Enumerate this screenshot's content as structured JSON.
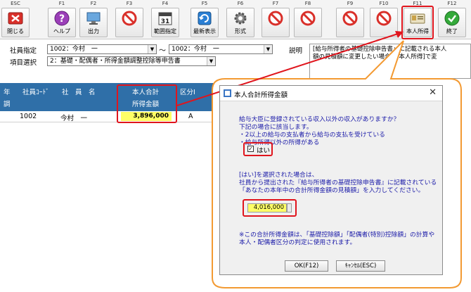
{
  "toolbar": {
    "fkeys": [
      "ESC",
      "F1",
      "F2",
      "F3",
      "F4",
      "F5",
      "F6",
      "F7",
      "F8",
      "F9",
      "F10",
      "F11",
      "F12"
    ],
    "buttons": {
      "close": "閉じる",
      "help": "ヘルプ",
      "output": "出力",
      "range": "範囲指定",
      "refresh": "最新表示",
      "format": "形式",
      "self_income": "本人所得",
      "exit": "終了"
    },
    "calendar_num": "31"
  },
  "header": {
    "employee_label": "社員指定",
    "employee_from": "1002：今村　一",
    "employee_to": "1002：今村　一",
    "tilde": "～",
    "item_label": "項目選択",
    "item_value": "2：基礎・配偶者・所得金額調整控除等申告書",
    "desc_label": "説明",
    "desc_lines": [
      "[給与所得者の基礎控除申告書」に記載される本人",
      "額の見積額に変更したい場合に[本人所得]で変"
    ]
  },
  "grid": {
    "col_nen": "年",
    "col_cho": "調",
    "col_code": "社員ｺｰﾄﾞ",
    "col_name": "社　員　名",
    "col_income_1": "本人合計",
    "col_income_2": "所得金額",
    "col_kubun": "区分Ⅰ",
    "row": {
      "code": "1002",
      "name": "今村　一",
      "amount": "3,896,000",
      "kubun": "A"
    }
  },
  "dialog": {
    "title": "本人合計所得金額",
    "close": "✕",
    "q_lines": [
      "給与大臣に登録されている収入以外の収入がありますか？",
      "下記の場合に該当します。",
      "・2以上の給与の支払者から給与の支払を受けている",
      "・給与所得以外の所得がある"
    ],
    "check_mark": "✓",
    "check_label": "はい",
    "info_lines": [
      "[はい]を選択された場合は、",
      "社員から提出された『給与所得者の基礎控除申告書』に記載されている",
      "「あなたの本年中の合計所得金額の見積額」を入力してください。"
    ],
    "amount": "4,016,000",
    "note_lines": [
      "※この合計所得金額は、「基礎控除額」「配偶者(特別)控除額」の計算や",
      "本人・配偶者区分の判定に使用されます。"
    ],
    "ok": "OK(F12)",
    "cancel": "ｷｬﾝｾﾙ(ESC)"
  },
  "colors": {
    "accent_red": "#e0151d",
    "header_blue": "#2f6fa8",
    "text_blue": "#1a1aa8",
    "highlight_yellow": "#ffff66",
    "bubble_orange": "#f39a32"
  }
}
